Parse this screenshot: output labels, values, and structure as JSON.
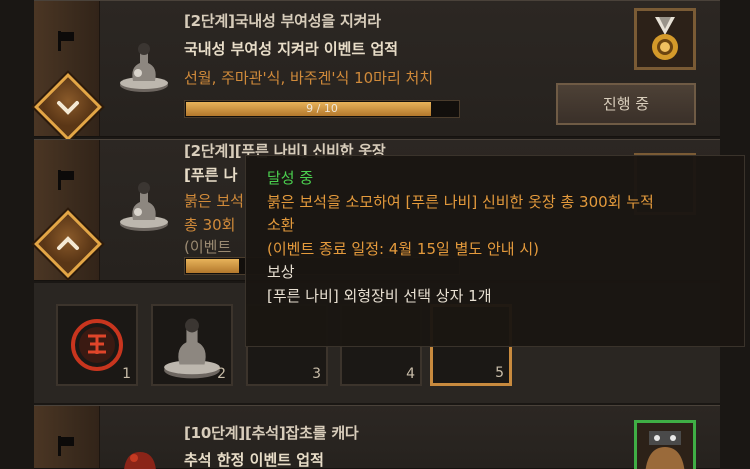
{
  "quests": [
    {
      "title": "[2단계]국내성 부여성을 지켜라",
      "subtitle": "국내성 부여성 지켜라 이벤트 업적",
      "desc": "선월, 주마관'식, 바주겐'식 10마리 처치",
      "progress_text": "9 / 10",
      "progress": 0.9,
      "button": "진행 중"
    },
    {
      "title": "[2단계][푸른 나비] 신비한 옷장",
      "subtitle": "[푸른 나",
      "desc": "붉은 보석",
      "desc2": "총 30회",
      "note": "(이벤트",
      "progress": 0.2
    },
    {
      "title": "[10단계][추석]잡초를 캐다",
      "subtitle": "추석 한정 이벤트 업적"
    }
  ],
  "slots": [
    "1",
    "2",
    "3",
    "4",
    "5"
  ],
  "tooltip": {
    "status": "달성 중",
    "line1": "붉은 보석을 소모하여 [푸른 나비] 신비한 옷장 총 300회 누적",
    "line2": "소환",
    "line3": "(이벤트 종료 일정: 4월 15일 별도 안내 시)",
    "reward_label": "보상",
    "reward_item": "[푸른 나비] 외형장비 선택 상자 1개"
  },
  "colors": {
    "accent_gold": "#e3a646",
    "progress_fill": "#d19a48",
    "status_green": "#4bd04f",
    "desc_orange": "#d08a3a"
  },
  "icons": [
    "flag-icon",
    "chevron-down-icon",
    "chevron-up-icon",
    "bottle-icon",
    "medal-icon",
    "seal-icon",
    "bag-icon"
  ]
}
